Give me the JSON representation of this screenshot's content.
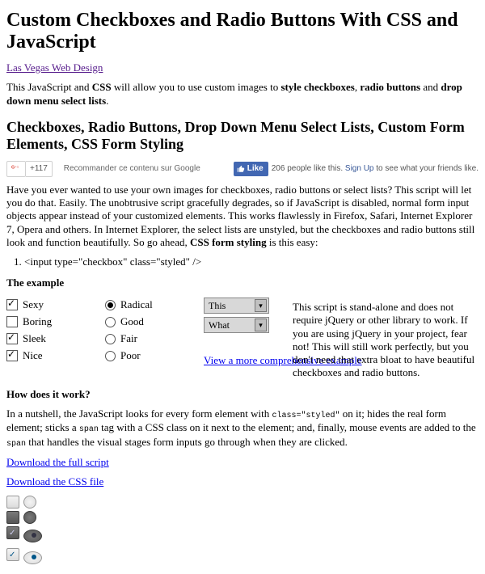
{
  "title": "Custom Checkboxes and Radio Buttons With CSS and JavaScript",
  "top_link": "Las Vegas Web Design",
  "intro_parts": {
    "a": "This JavaScript and ",
    "b": "CSS",
    "c": " will allow you to use custom images to ",
    "d": "style checkboxes",
    "e": ", ",
    "f": "radio buttons",
    "g": " and ",
    "h": "drop down menu select lists",
    "i": "."
  },
  "h2": "Checkboxes, Radio Buttons, Drop Down Menu Select Lists, Custom Form Elements, CSS Form Styling",
  "social": {
    "gplus_count": "+117",
    "gplus_rec": "Recommander ce contenu sur Google",
    "fb_like": "Like",
    "fb_text_a": "206 people like this. ",
    "fb_signup": "Sign Up",
    "fb_text_b": " to see what your friends like."
  },
  "desc": {
    "a": "Have you ever wanted to use your own images for checkboxes, radio buttons or select lists? This script will let you do that. Easily. The unobtrusive script gracefully degrades, so if JavaScript is disabled, normal form input objects appear instead of your customized elements. This works flawlessly in Firefox, Safari, Internet Explorer 7, Opera and others. In Internet Explorer, the select lists are unstyled, but the checkboxes and radio buttons still look and function beautifully. So go ahead, ",
    "b": "CSS form styling",
    "c": " is this easy:"
  },
  "code_line": "<input type=\"checkbox\" class=\"styled\" />",
  "h3_example": "The example",
  "checks": [
    {
      "label": "Sexy",
      "checked": true
    },
    {
      "label": "Boring",
      "checked": false
    },
    {
      "label": "Sleek",
      "checked": true
    },
    {
      "label": "Nice",
      "checked": true
    }
  ],
  "radios": [
    {
      "label": "Radical",
      "checked": true
    },
    {
      "label": "Good",
      "checked": false
    },
    {
      "label": "Fair",
      "checked": false
    },
    {
      "label": "Poor",
      "checked": false
    }
  ],
  "selects": {
    "a": "This",
    "b": "What"
  },
  "note": "This script is stand-alone and does not require jQuery or other library to work. If you are using jQuery in your project, fear not! This will still work perfectly, but you don't need that extra bloat to have beautiful checkboxes and radio buttons.",
  "more_link": "View a more comprehensive example",
  "h3_how": "How does it work?",
  "how": {
    "a": "In a nutshell, the JavaScript looks for every form element with ",
    "b": "class=\"styled\"",
    "c": " on it; hides the real form element; sticks a ",
    "d": "span",
    "e": " tag with a CSS class on it next to the element; and, finally, mouse events are added to the ",
    "f": "span",
    "g": " that handles the visual stages form inputs go through when they are clicked."
  },
  "dl_script": "Download the full script",
  "dl_css": "Download the CSS file"
}
